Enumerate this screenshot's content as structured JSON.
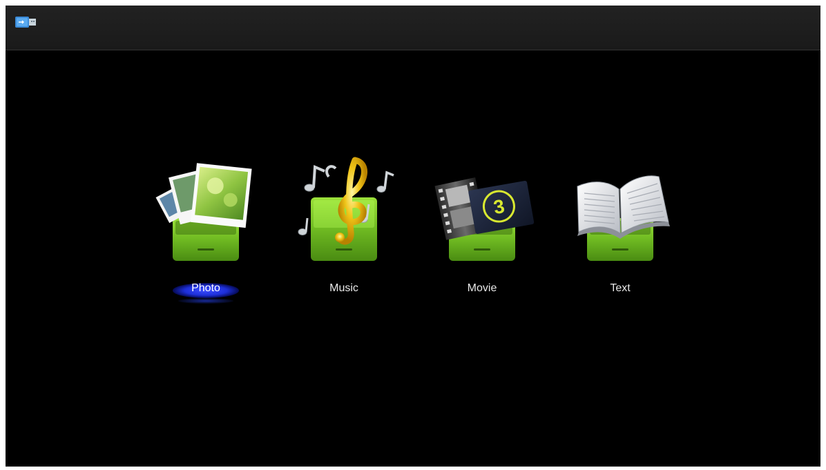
{
  "menu": {
    "items": [
      {
        "label": "Photo",
        "icon": "photo-icon",
        "selected": true
      },
      {
        "label": "Music",
        "icon": "music-icon",
        "selected": false
      },
      {
        "label": "Movie",
        "icon": "movie-icon",
        "selected": false
      },
      {
        "label": "Text",
        "icon": "text-icon",
        "selected": false
      }
    ]
  },
  "status": {
    "icon": "usb-drive-icon"
  },
  "colors": {
    "background": "#000000",
    "topbar": "#1e1e1e",
    "drawer_green": "#7cc52a",
    "selection_blue": "#2234e6",
    "label": "#e8e8e8"
  }
}
